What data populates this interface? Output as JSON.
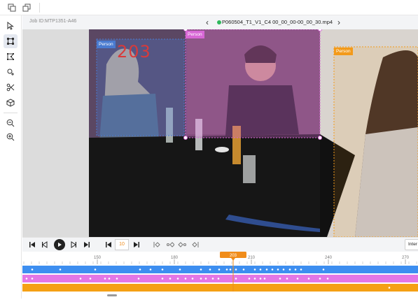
{
  "header": {
    "job_id": "Job ID:MTP1351-A46",
    "filename": "P060504_T1_V1_C4 00_00_00-00_00_30.mp4",
    "prev_icon": "chevron-left-icon",
    "next_icon": "chevron-right-icon"
  },
  "topbar": {
    "icons": [
      "copy-icon",
      "duplicate-icon"
    ]
  },
  "toolbar": {
    "tools": [
      {
        "name": "select-tool",
        "icon": "cursor-icon",
        "active": false
      },
      {
        "name": "bbox-tool",
        "icon": "bounding-box-icon",
        "active": true
      },
      {
        "name": "polygon-tool",
        "icon": "polygon-icon",
        "active": false
      },
      {
        "name": "keypoint-tool",
        "icon": "keypoint-add-icon",
        "active": false
      },
      {
        "name": "cut-tool",
        "icon": "scissors-icon",
        "active": false
      },
      {
        "name": "cuboid-tool",
        "icon": "cube-icon",
        "active": false
      },
      {
        "name": "zoom-out-tool",
        "icon": "zoom-out-icon",
        "active": false
      },
      {
        "name": "zoom-in-tool",
        "icon": "zoom-in-icon",
        "active": false
      }
    ]
  },
  "annotations": [
    {
      "label": "Person",
      "track_id": "203",
      "color": "#4a7bd0"
    },
    {
      "label": "Person",
      "color": "#d867d6"
    },
    {
      "label": "Person",
      "color": "#f39a1a"
    }
  ],
  "controls": {
    "current_frame": "10",
    "interpolation_label": "Inter",
    "buttons": [
      "skip-to-start-icon",
      "step-back-icon",
      "play-icon",
      "step-forward-icon",
      "skip-to-end-icon",
      "prev-keyframe-icon",
      "next-keyframe-icon",
      "prev-interp-icon",
      "prev-interp-2-icon",
      "next-interp-icon",
      "next-interp-2-icon"
    ]
  },
  "timeline": {
    "ticks": [
      "150",
      "180",
      "210",
      "240",
      "270"
    ],
    "current_frame_marker": "203",
    "tracks": [
      {
        "name": "blue-track",
        "color": "#3d8ef0"
      },
      {
        "name": "pink-track",
        "color": "#e377e6"
      },
      {
        "name": "orange-track",
        "color": "#f5a014"
      }
    ],
    "playhead_color": "#f08c1a"
  },
  "colors": {
    "accent": "#f08c1a",
    "active_tool_bg": "#e4e8f0"
  }
}
